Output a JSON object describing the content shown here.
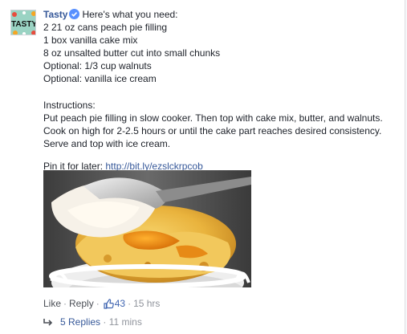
{
  "comment": {
    "author": "Tasty",
    "intro": "Here's what you need:",
    "ingredients": [
      "2 21 oz cans peach pie filling",
      "1 box vanilla cake mix",
      "8 oz unsalted butter cut into small chunks",
      "Optional: 1/3 cup walnuts",
      "Optional: vanilla ice cream"
    ],
    "instructions_heading": "Instructions:",
    "instructions": "Put peach pie filling in slow cooker. Then top with cake mix, butter, and walnuts. Cook on high for 2-2.5 hours or until the cake part reaches desired consistency. Serve and top with ice cream.",
    "pin_label": "Pin it for later:",
    "pin_link": "http://bit.ly/ezslckrpcob"
  },
  "avatar": {
    "logo_text": "TASTY"
  },
  "actions": {
    "like_label": "Like",
    "dot": "·",
    "reply_label": "Reply",
    "like_count": "43",
    "time": "15 hrs"
  },
  "replies": {
    "label": "5 Replies",
    "dot": "·",
    "time": "11 mins"
  },
  "colors": {
    "link": "#365899",
    "meta": "#90949c",
    "like": "#4267b2",
    "verified": "#5890ff"
  }
}
